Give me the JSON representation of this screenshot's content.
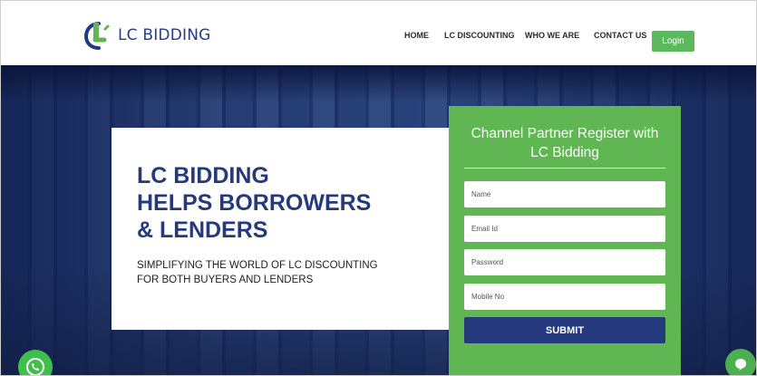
{
  "header": {
    "logo_text": "LC BIDDING",
    "nav": [
      {
        "label": "HOME"
      },
      {
        "label": "LC DISCOUNTING"
      },
      {
        "label": "WHO WE ARE"
      },
      {
        "label": "CONTACT US"
      }
    ],
    "login_label": "Login"
  },
  "hero": {
    "headline_lines": [
      "LC BIDDING",
      "HELPS BORROWERS",
      "& LENDERS"
    ],
    "subline_lines": [
      "SIMPLIFYING THE WORLD OF LC DISCOUNTING",
      "FOR BOTH BUYERS AND LENDERS"
    ]
  },
  "form": {
    "title_lines": [
      "Channel Partner Register with",
      "LC Bidding"
    ],
    "fields": [
      {
        "placeholder": "Name"
      },
      {
        "placeholder": "Email Id"
      },
      {
        "placeholder": "Password"
      },
      {
        "placeholder": "Mobile No"
      }
    ],
    "submit_label": "SUBMIT"
  },
  "colors": {
    "brand_blue": "#25397d",
    "brand_green": "#5fb653",
    "login_green": "#5cb85c"
  },
  "icons": {
    "logo": "lc-logo-icon",
    "whatsapp": "whatsapp-icon",
    "chat": "chat-icon"
  }
}
